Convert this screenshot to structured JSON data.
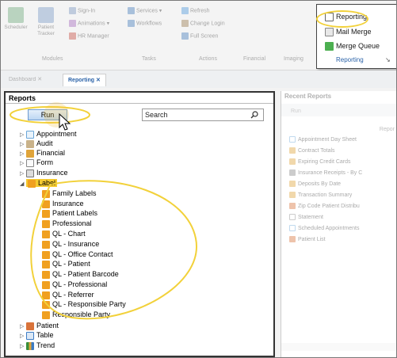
{
  "ribbon": {
    "scheduler_label": "Scheduler",
    "patient_tracker_label": "Patient\nTracker",
    "sign_in_label": "Sign-In",
    "animations_label": "Animations ▾",
    "hr_manager_label": "HR Manager",
    "services_label": "Services ▾",
    "workflows_label": "Workflows",
    "refresh_label": "Refresh",
    "change_login_label": "Change Login",
    "full_screen_label": "Full Screen",
    "groups": [
      "Modules",
      "Tasks",
      "Actions",
      "Financial",
      "Imaging"
    ],
    "reporting_group": {
      "reporting_label": "Reporting",
      "mail_merge_label": "Mail Merge",
      "merge_queue_label": "Merge Queue",
      "group_label": "Reporting"
    }
  },
  "tabs": [
    {
      "label": "Dashboard ✕"
    },
    {
      "label": "Reporting ✕"
    }
  ],
  "reports_pane": {
    "title": "Reports",
    "run_label": "Run",
    "search_placeholder": "Search",
    "tree": [
      {
        "label": "Appointment",
        "expanded": false
      },
      {
        "label": "Audit",
        "expanded": false
      },
      {
        "label": "Financial",
        "expanded": false
      },
      {
        "label": "Form",
        "expanded": false
      },
      {
        "label": "Insurance",
        "expanded": false
      },
      {
        "label": "Label",
        "expanded": true,
        "selected": true
      },
      {
        "label": "Family Labels",
        "child": true
      },
      {
        "label": "Insurance",
        "child": true
      },
      {
        "label": "Patient Labels",
        "child": true
      },
      {
        "label": "Professional",
        "child": true
      },
      {
        "label": "QL - Chart",
        "child": true
      },
      {
        "label": "QL - Insurance",
        "child": true
      },
      {
        "label": "QL - Office Contact",
        "child": true
      },
      {
        "label": "QL - Patient",
        "child": true
      },
      {
        "label": "QL - Patient Barcode",
        "child": true
      },
      {
        "label": "QL - Professional",
        "child": true
      },
      {
        "label": "QL - Referrer",
        "child": true
      },
      {
        "label": "QL - Responsible Party",
        "child": true
      },
      {
        "label": "Responsible Party",
        "child": true
      },
      {
        "label": "Patient",
        "expanded": false
      },
      {
        "label": "Table",
        "expanded": false
      },
      {
        "label": "Trend",
        "expanded": false
      }
    ]
  },
  "recent_pane": {
    "title": "Recent Reports",
    "run_label": "Run",
    "column_header": "Repor",
    "items": [
      "Appointment Day Sheet",
      "Contract Totals",
      "Expiring Credit Cards",
      "Insurance Receipts - By C",
      "Deposits By Date",
      "Transaction Summary",
      "Zip Code Patient Distribu",
      "Statement",
      "Scheduled Appointments",
      "Patient List"
    ]
  },
  "colors": {
    "highlight": "#f2d13a",
    "selection": "#f5ca2e",
    "run_button": "#bcd6f2",
    "label_icon": "#f0a020"
  }
}
